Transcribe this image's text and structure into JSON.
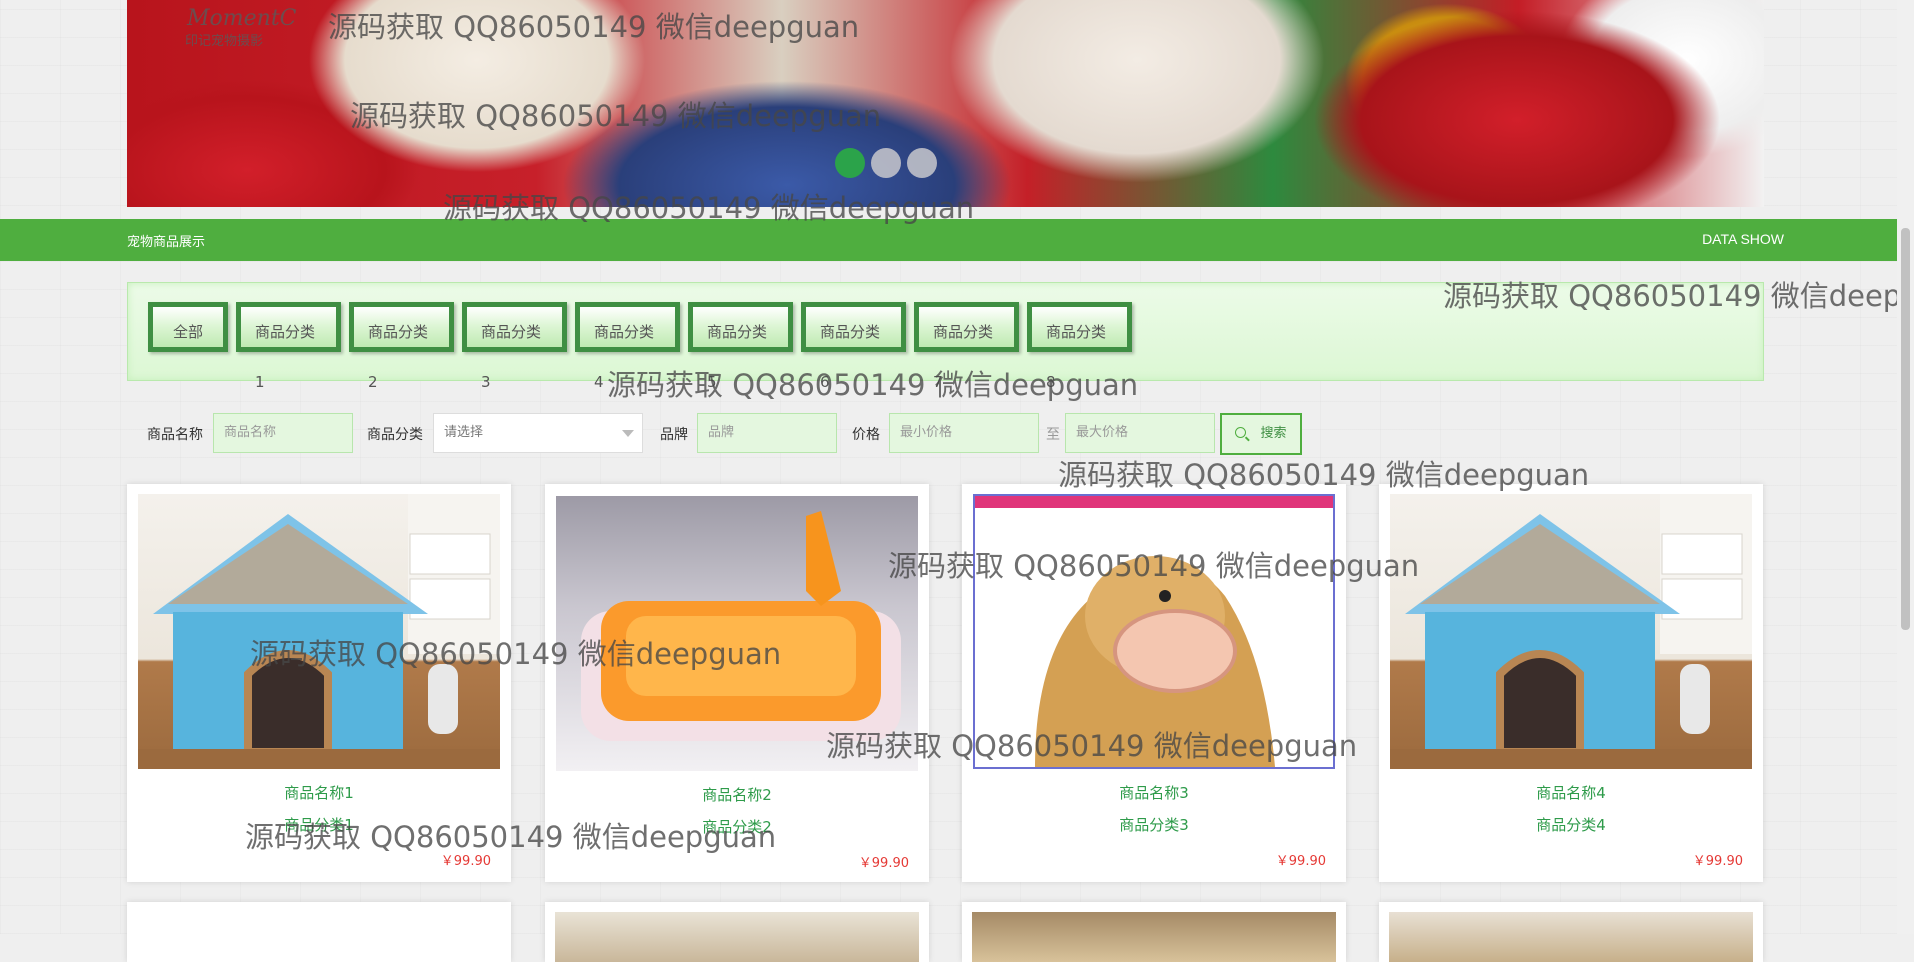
{
  "banner": {
    "logo_text": "MomentC",
    "logo_sub": "印记宠物摄影",
    "slides": 3,
    "active_slide": 1
  },
  "bar": {
    "left_title": "宠物商品展示",
    "right_title": "DATA SHOW"
  },
  "categories": [
    "全部",
    "商品分类1",
    "商品分类2",
    "商品分类3",
    "商品分类4",
    "商品分类5",
    "商品分类6",
    "商品分类7",
    "商品分类8"
  ],
  "search": {
    "name_label": "商品名称",
    "name_placeholder": "商品名称",
    "category_label": "商品分类",
    "category_placeholder": "请选择",
    "brand_label": "品牌",
    "brand_placeholder": "品牌",
    "price_label": "价格",
    "min_placeholder": "最小价格",
    "to_text": "至",
    "max_placeholder": "最大价格",
    "button_label": "搜索"
  },
  "products": [
    {
      "name": "商品名称1",
      "category": "商品分类1",
      "price": "￥99.90",
      "image": "pet-house"
    },
    {
      "name": "商品名称2",
      "category": "商品分类2",
      "price": "￥99.90",
      "image": "litter-box"
    },
    {
      "name": "商品名称3",
      "category": "商品分类3",
      "price": "￥99.90",
      "image": "dog-muzzle"
    },
    {
      "name": "商品名称4",
      "category": "商品分类4",
      "price": "￥99.90",
      "image": "pet-house"
    }
  ],
  "watermark": "源码获取 QQ86050149 微信deepguan",
  "colors": {
    "primary_green": "#4fae3f",
    "dark_green": "#3f8f43",
    "text_green": "#2e9b4a",
    "price_red": "#e53935"
  }
}
